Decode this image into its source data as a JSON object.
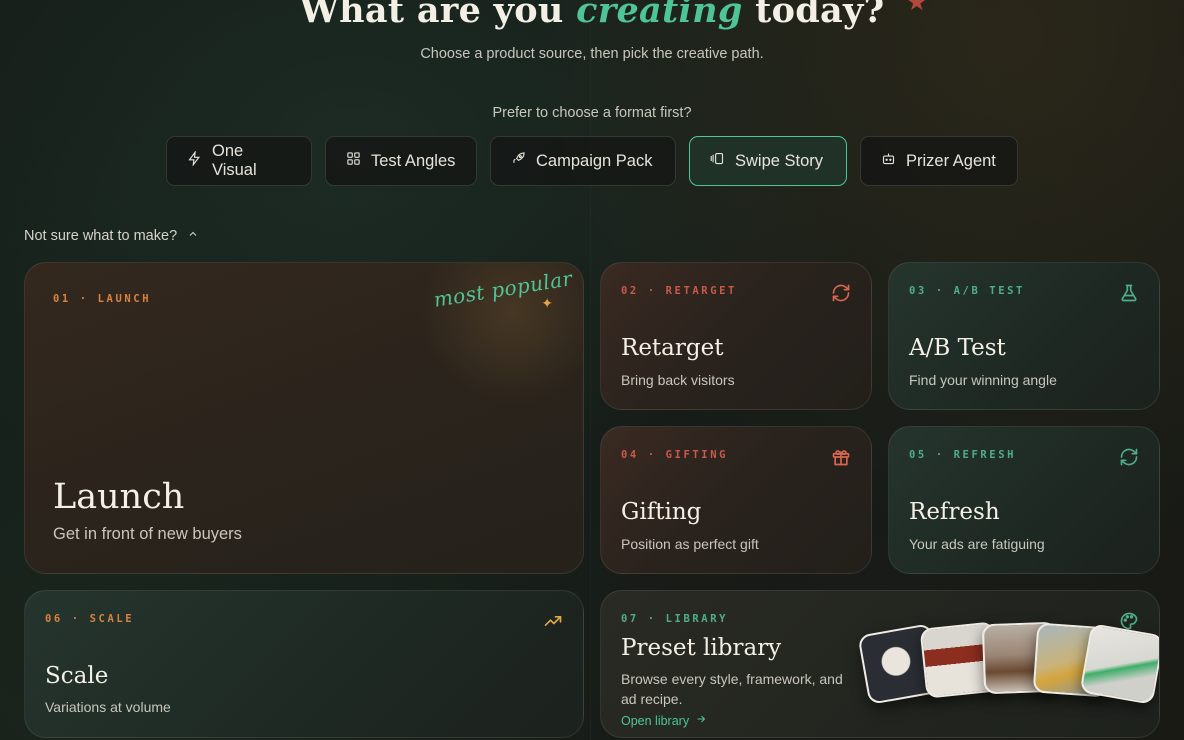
{
  "hero": {
    "title_before": "What are you ",
    "title_accent": "creating",
    "title_after": " today?",
    "subtitle": "Choose a product source, then pick the creative path."
  },
  "formats": {
    "prompt": "Prefer to choose a format first?",
    "items": [
      {
        "label": "One Visual",
        "icon": "lightning-icon",
        "active": false
      },
      {
        "label": "Test Angles",
        "icon": "grid-icon",
        "active": false
      },
      {
        "label": "Campaign Pack",
        "icon": "rocket-icon",
        "active": false
      },
      {
        "label": "Swipe Story",
        "icon": "carousel-icon",
        "active": true
      },
      {
        "label": "Prizer Agent",
        "icon": "robot-icon",
        "active": false
      }
    ]
  },
  "not_sure": {
    "label": "Not sure what to make?",
    "icon": "chevron-up-icon"
  },
  "cards": {
    "launch": {
      "tag": "01 · LAUNCH",
      "title": "Launch",
      "subtitle": "Get in front of new buyers",
      "badge": "most popular"
    },
    "retarget": {
      "tag": "02 · RETARGET",
      "title": "Retarget",
      "subtitle": "Bring back visitors",
      "icon": "refresh-icon"
    },
    "abtest": {
      "tag": "03 · A/B TEST",
      "title": "A/B Test",
      "subtitle": "Find your winning angle",
      "icon": "flask-icon"
    },
    "gifting": {
      "tag": "04 · GIFTING",
      "title": "Gifting",
      "subtitle": "Position as perfect gift",
      "icon": "gift-icon"
    },
    "refresh": {
      "tag": "05 · REFRESH",
      "title": "Refresh",
      "subtitle": "Your ads are fatiguing",
      "icon": "refresh-icon"
    },
    "scale": {
      "tag": "06 · SCALE",
      "title": "Scale",
      "subtitle": "Variations at volume",
      "icon": "trending-up-icon"
    },
    "library": {
      "tag": "07 · LIBRARY",
      "title": "Preset library",
      "subtitle": "Browse every style, framework, and ad recipe.",
      "link": "Open library",
      "icon": "palette-icon"
    }
  },
  "colors": {
    "accent_green": "#4fc497",
    "tag_orange": "#d9823f",
    "tag_red": "#c9594a",
    "tag_green": "#4fae8a"
  }
}
